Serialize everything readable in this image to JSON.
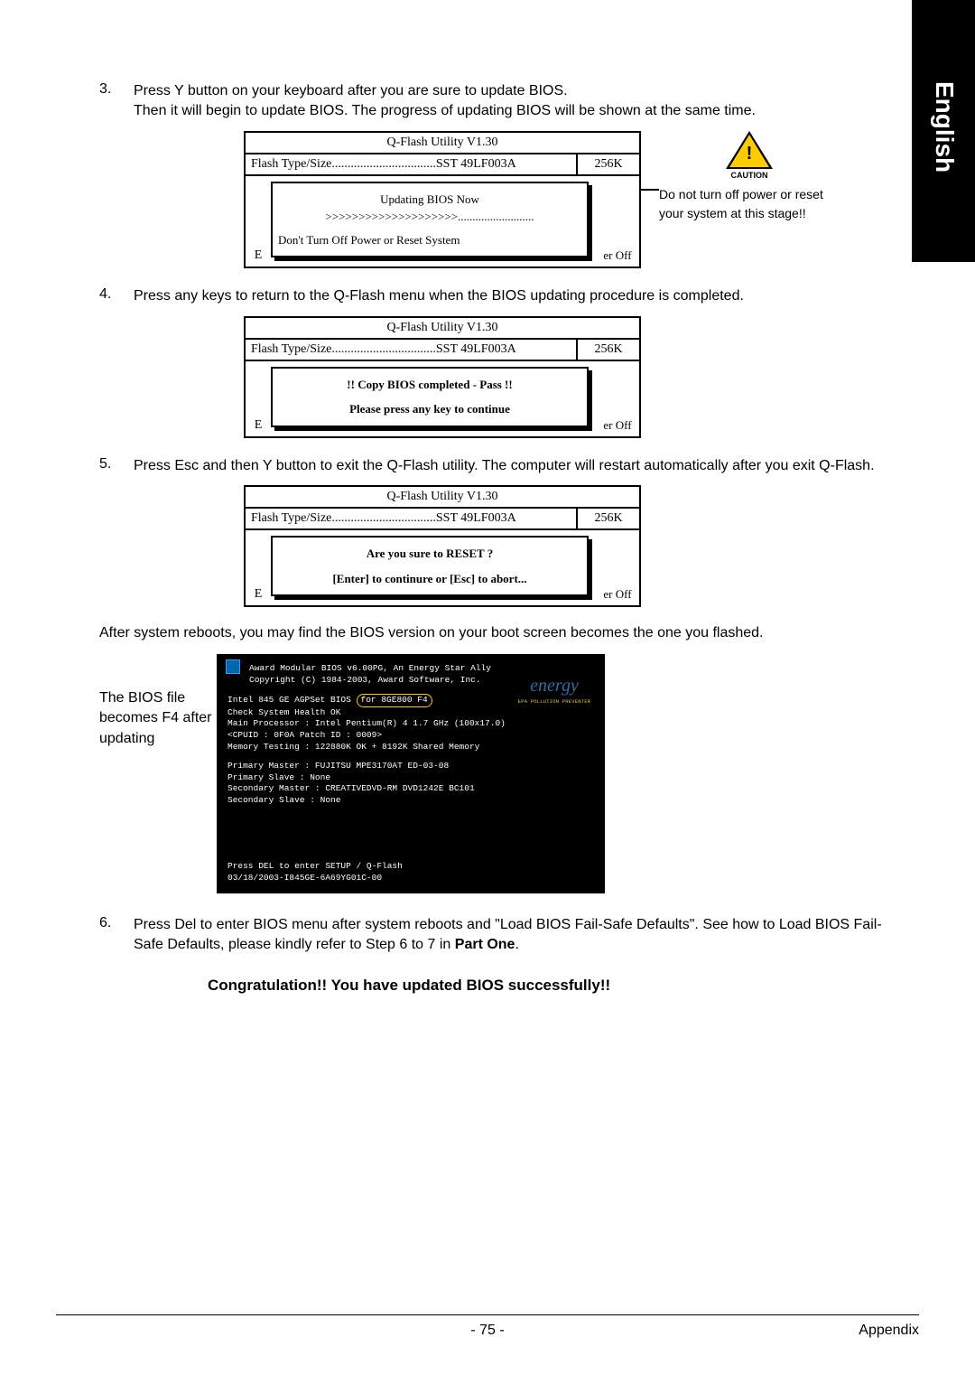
{
  "side_tab": "English",
  "steps": {
    "s3": {
      "num": "3.",
      "text1": "Press Y button on your keyboard after you are sure to update BIOS.",
      "text2": "Then it will begin to update BIOS. The progress of updating BIOS will be shown at the same time."
    },
    "s4": {
      "num": "4.",
      "text": "Press any keys to return to the Q-Flash menu when the BIOS updating procedure is completed."
    },
    "s5": {
      "num": "5.",
      "text": "Press Esc and then Y button to exit the Q-Flash utility. The computer will restart automatically after you exit Q-Flash."
    },
    "s6": {
      "num": "6.",
      "text": "Press Del to enter BIOS menu after system reboots and \"Load BIOS Fail-Safe Defaults\". See how to Load BIOS Fail-Safe Defaults, please kindly refer to Step 6 to 7 in Part One."
    }
  },
  "qflash": {
    "title": "Q-Flash Utility V1.30",
    "flash_left": "Flash Type/Size.................................SST 49LF003A",
    "flash_right": "256K",
    "e": "E",
    "off": "er Off",
    "box1_line1": "Updating BIOS Now",
    "box1_line2": ">>>>>>>>>>>>>>>>>>>>..........................",
    "box1_foot": "Don't Turn Off Power or Reset System",
    "box2_line1": "!! Copy BIOS completed - Pass !!",
    "box2_line2": "Please press any key to continue",
    "box3_line1": "Are you sure to RESET ?",
    "box3_line2": "[Enter] to continure or [Esc] to abort..."
  },
  "caution": {
    "label": "CAUTION",
    "text": "Do not turn off power or reset your system at this stage!!"
  },
  "after": "After system reboots, you may find the BIOS version on your boot screen becomes the one you flashed.",
  "bios_note": "The BIOS file becomes F4 after updating",
  "bios": {
    "head1": "Award Modular BIOS v6.00PG, An Energy Star Ally",
    "head2": "Copyright (C) 1984-2003, Award Software, Inc.",
    "l1a": "Intel 845 GE AGPSet BIOS ",
    "l1b": "for 8GE800 F4",
    "l2": "Check System Health OK",
    "l3": "Main Processor : Intel Pentium(R) 4  1.7 GHz (100x17.0)",
    "l4": "<CPUID : 0F0A Patch ID : 0009>",
    "l5": "Memory Testing  : 122880K OK + 8192K Shared Memory",
    "l6": "Primary Master : FUJITSU MPE3170AT ED-03-08",
    "l7": "Primary Slave : None",
    "l8": "Secondary Master : CREATIVEDVD-RM DVD1242E BC101",
    "l9": "Secondary Slave : None",
    "b1": "Press DEL to enter SETUP / Q-Flash",
    "b2": "03/18/2003-I845GE-6A69YG01C-00",
    "energy": "energy",
    "energy_sub": "EPA POLLUTION PREVENTER"
  },
  "congrat": "Congratulation!! You have updated BIOS successfully!!",
  "footer": {
    "page": "- 75 -",
    "section": "Appendix"
  }
}
